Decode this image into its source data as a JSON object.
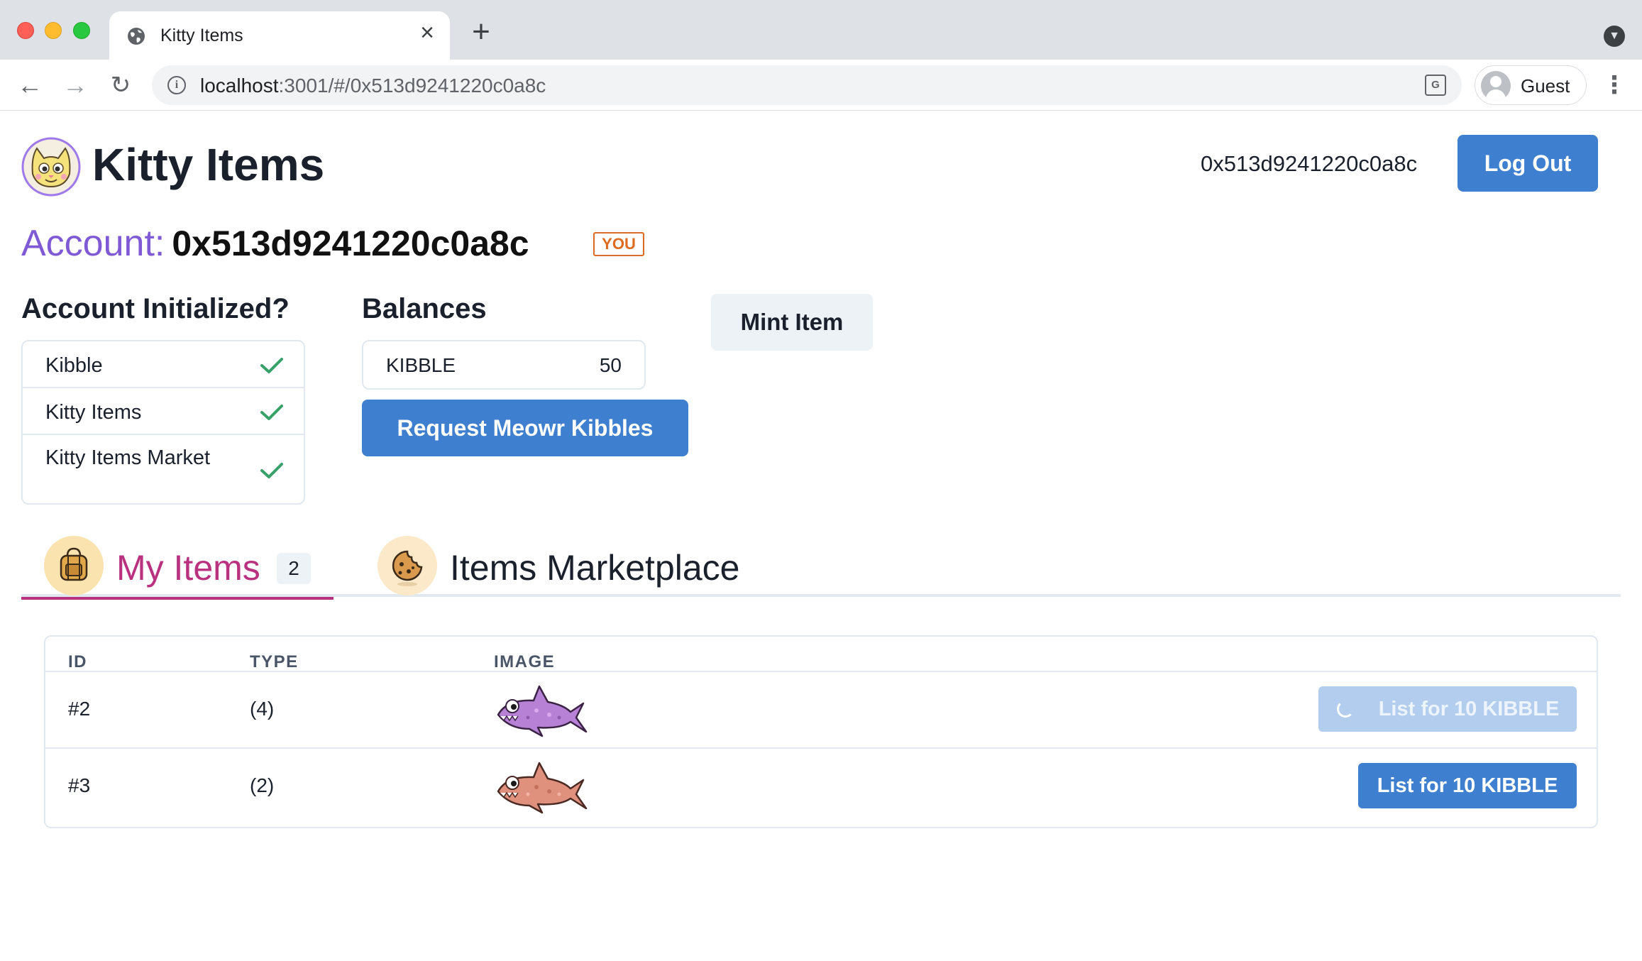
{
  "browser": {
    "tab_title": "Kitty Items",
    "url_host": "localhost",
    "url_rest": ":3001/#/0x513d9241220c0a8c",
    "profile_label": "Guest"
  },
  "header": {
    "app_title": "Kitty Items",
    "address": "0x513d9241220c0a8c",
    "logout_label": "Log Out"
  },
  "account": {
    "label": "Account:",
    "address": "0x513d9241220c0a8c",
    "badge": "YOU"
  },
  "init": {
    "heading": "Account Initialized?",
    "items": [
      {
        "label": "Kibble",
        "initialized": true
      },
      {
        "label": "Kitty Items",
        "initialized": true
      },
      {
        "label": "Kitty Items Market",
        "initialized": true
      }
    ]
  },
  "balances": {
    "heading": "Balances",
    "items": [
      {
        "token": "KIBBLE",
        "amount": "50"
      }
    ],
    "request_label": "Request Meowr Kibbles"
  },
  "mint_label": "Mint Item",
  "tabs": [
    {
      "label": "My Items",
      "count": "2",
      "active": true,
      "icon": "backpack-icon"
    },
    {
      "label": "Items Marketplace",
      "active": false,
      "icon": "cookie-icon"
    }
  ],
  "table": {
    "headers": [
      "ID",
      "TYPE",
      "IMAGE"
    ],
    "rows": [
      {
        "id": "#2",
        "type": "(4)",
        "image": "purple-shark",
        "action": "List for 10 KIBBLE",
        "loading": true
      },
      {
        "id": "#3",
        "type": "(2)",
        "image": "orange-shark",
        "action": "List for 10 KIBBLE",
        "loading": false
      }
    ]
  },
  "colors": {
    "primary": "#3f7fcf",
    "account_label": "#805ad5",
    "active_tab": "#b83280",
    "badge": "#dd6b20",
    "check": "#38a169"
  }
}
